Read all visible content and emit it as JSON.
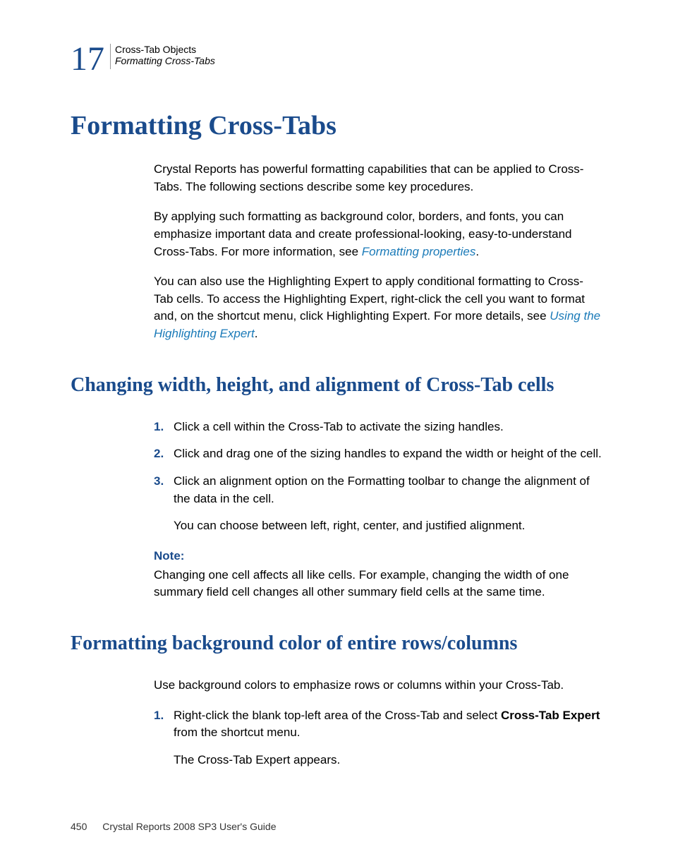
{
  "header": {
    "chapter_number": "17",
    "line1": "Cross-Tab Objects",
    "line2": "Formatting Cross-Tabs"
  },
  "h1": "Formatting Cross-Tabs",
  "intro": {
    "p1": "Crystal Reports has powerful formatting capabilities that can be applied to Cross-Tabs. The following sections describe some key procedures.",
    "p2_a": "By applying such formatting as background color, borders, and fonts, you can emphasize important data and create professional-looking, easy-to-understand Cross-Tabs. For more information, see ",
    "p2_link": "Formatting properties",
    "p2_b": ".",
    "p3_a": "You can also use the Highlighting Expert to apply conditional formatting to Cross-Tab cells. To access the Highlighting Expert, right-click the cell you want to format and, on the shortcut menu, click Highlighting Expert. For more details, see ",
    "p3_link": "Using the Highlighting Expert",
    "p3_b": "."
  },
  "section1": {
    "title": "Changing width, height, and alignment of Cross-Tab cells",
    "steps": [
      {
        "num": "1.",
        "text": "Click a cell within the Cross-Tab to activate the sizing handles."
      },
      {
        "num": "2.",
        "text": "Click and drag one of the sizing handles to expand the width or height of the cell."
      },
      {
        "num": "3.",
        "text": "Click an alignment option on the Formatting toolbar to change the alignment of the data in the cell."
      }
    ],
    "sub_para": "You can choose between left, right, center, and justified alignment.",
    "note_label": "Note:",
    "note_text": "Changing one cell affects all like cells. For example, changing the width of one summary field cell changes all other summary field cells at the same time."
  },
  "section2": {
    "title": "Formatting background color of entire rows/columns",
    "intro": "Use background colors to emphasize rows or columns within your Cross-Tab.",
    "steps": [
      {
        "num": "1.",
        "text_a": "Right-click the blank top-left area of the Cross-Tab and select ",
        "bold": "Cross-Tab Expert",
        "text_b": " from the shortcut menu."
      }
    ],
    "sub_para": "The Cross-Tab Expert appears."
  },
  "footer": {
    "page": "450",
    "text": "Crystal Reports 2008 SP3 User's Guide"
  }
}
